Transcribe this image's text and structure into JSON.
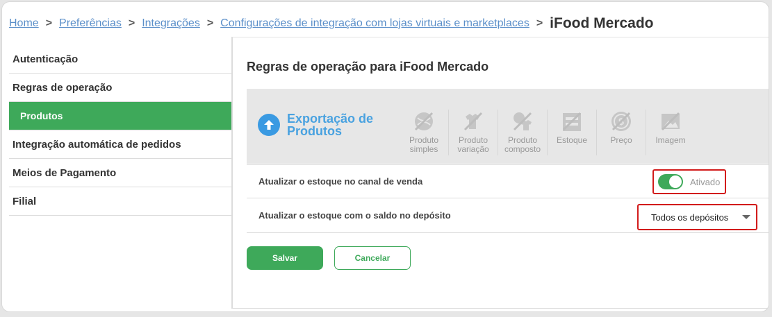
{
  "breadcrumb": {
    "items": [
      "Home",
      "Preferências",
      "Integrações",
      "Configurações de integração com lojas virtuais e marketplaces"
    ],
    "current": "iFood Mercado",
    "separator": ">"
  },
  "sidebar": {
    "items": [
      {
        "label": "Autenticação",
        "active": false
      },
      {
        "label": "Regras de operação",
        "active": false
      },
      {
        "label": "Produtos",
        "active": true
      },
      {
        "label": "Integração automática de pedidos",
        "active": false
      },
      {
        "label": "Meios de Pagamento",
        "active": false
      },
      {
        "label": "Filial",
        "active": false
      }
    ]
  },
  "main": {
    "title": "Regras de operação para iFood Mercado",
    "export": {
      "title": "Exportação de Produtos",
      "features": [
        {
          "icon": "product-simple-disabled-icon",
          "label": "Produto simples"
        },
        {
          "icon": "product-variation-disabled-icon",
          "label": "Produto variação"
        },
        {
          "icon": "product-composite-disabled-icon",
          "label": "Produto composto"
        },
        {
          "icon": "stock-disabled-icon",
          "label": "Estoque"
        },
        {
          "icon": "price-disabled-icon",
          "label": "Preço"
        },
        {
          "icon": "image-disabled-icon",
          "label": "Imagem"
        }
      ]
    },
    "rows": {
      "update_stock": {
        "label": "Atualizar o estoque no canal de venda",
        "toggle_label": "Ativado",
        "enabled": true
      },
      "stock_deposit": {
        "label": "Atualizar o estoque com o saldo no depósito",
        "selected": "Todos os depósitos"
      }
    },
    "buttons": {
      "save": "Salvar",
      "cancel": "Cancelar"
    }
  },
  "colors": {
    "accent_green": "#3ea95a",
    "link_blue": "#5b8fc9",
    "export_blue": "#49a2e0",
    "highlight_red": "#d21b1b"
  }
}
